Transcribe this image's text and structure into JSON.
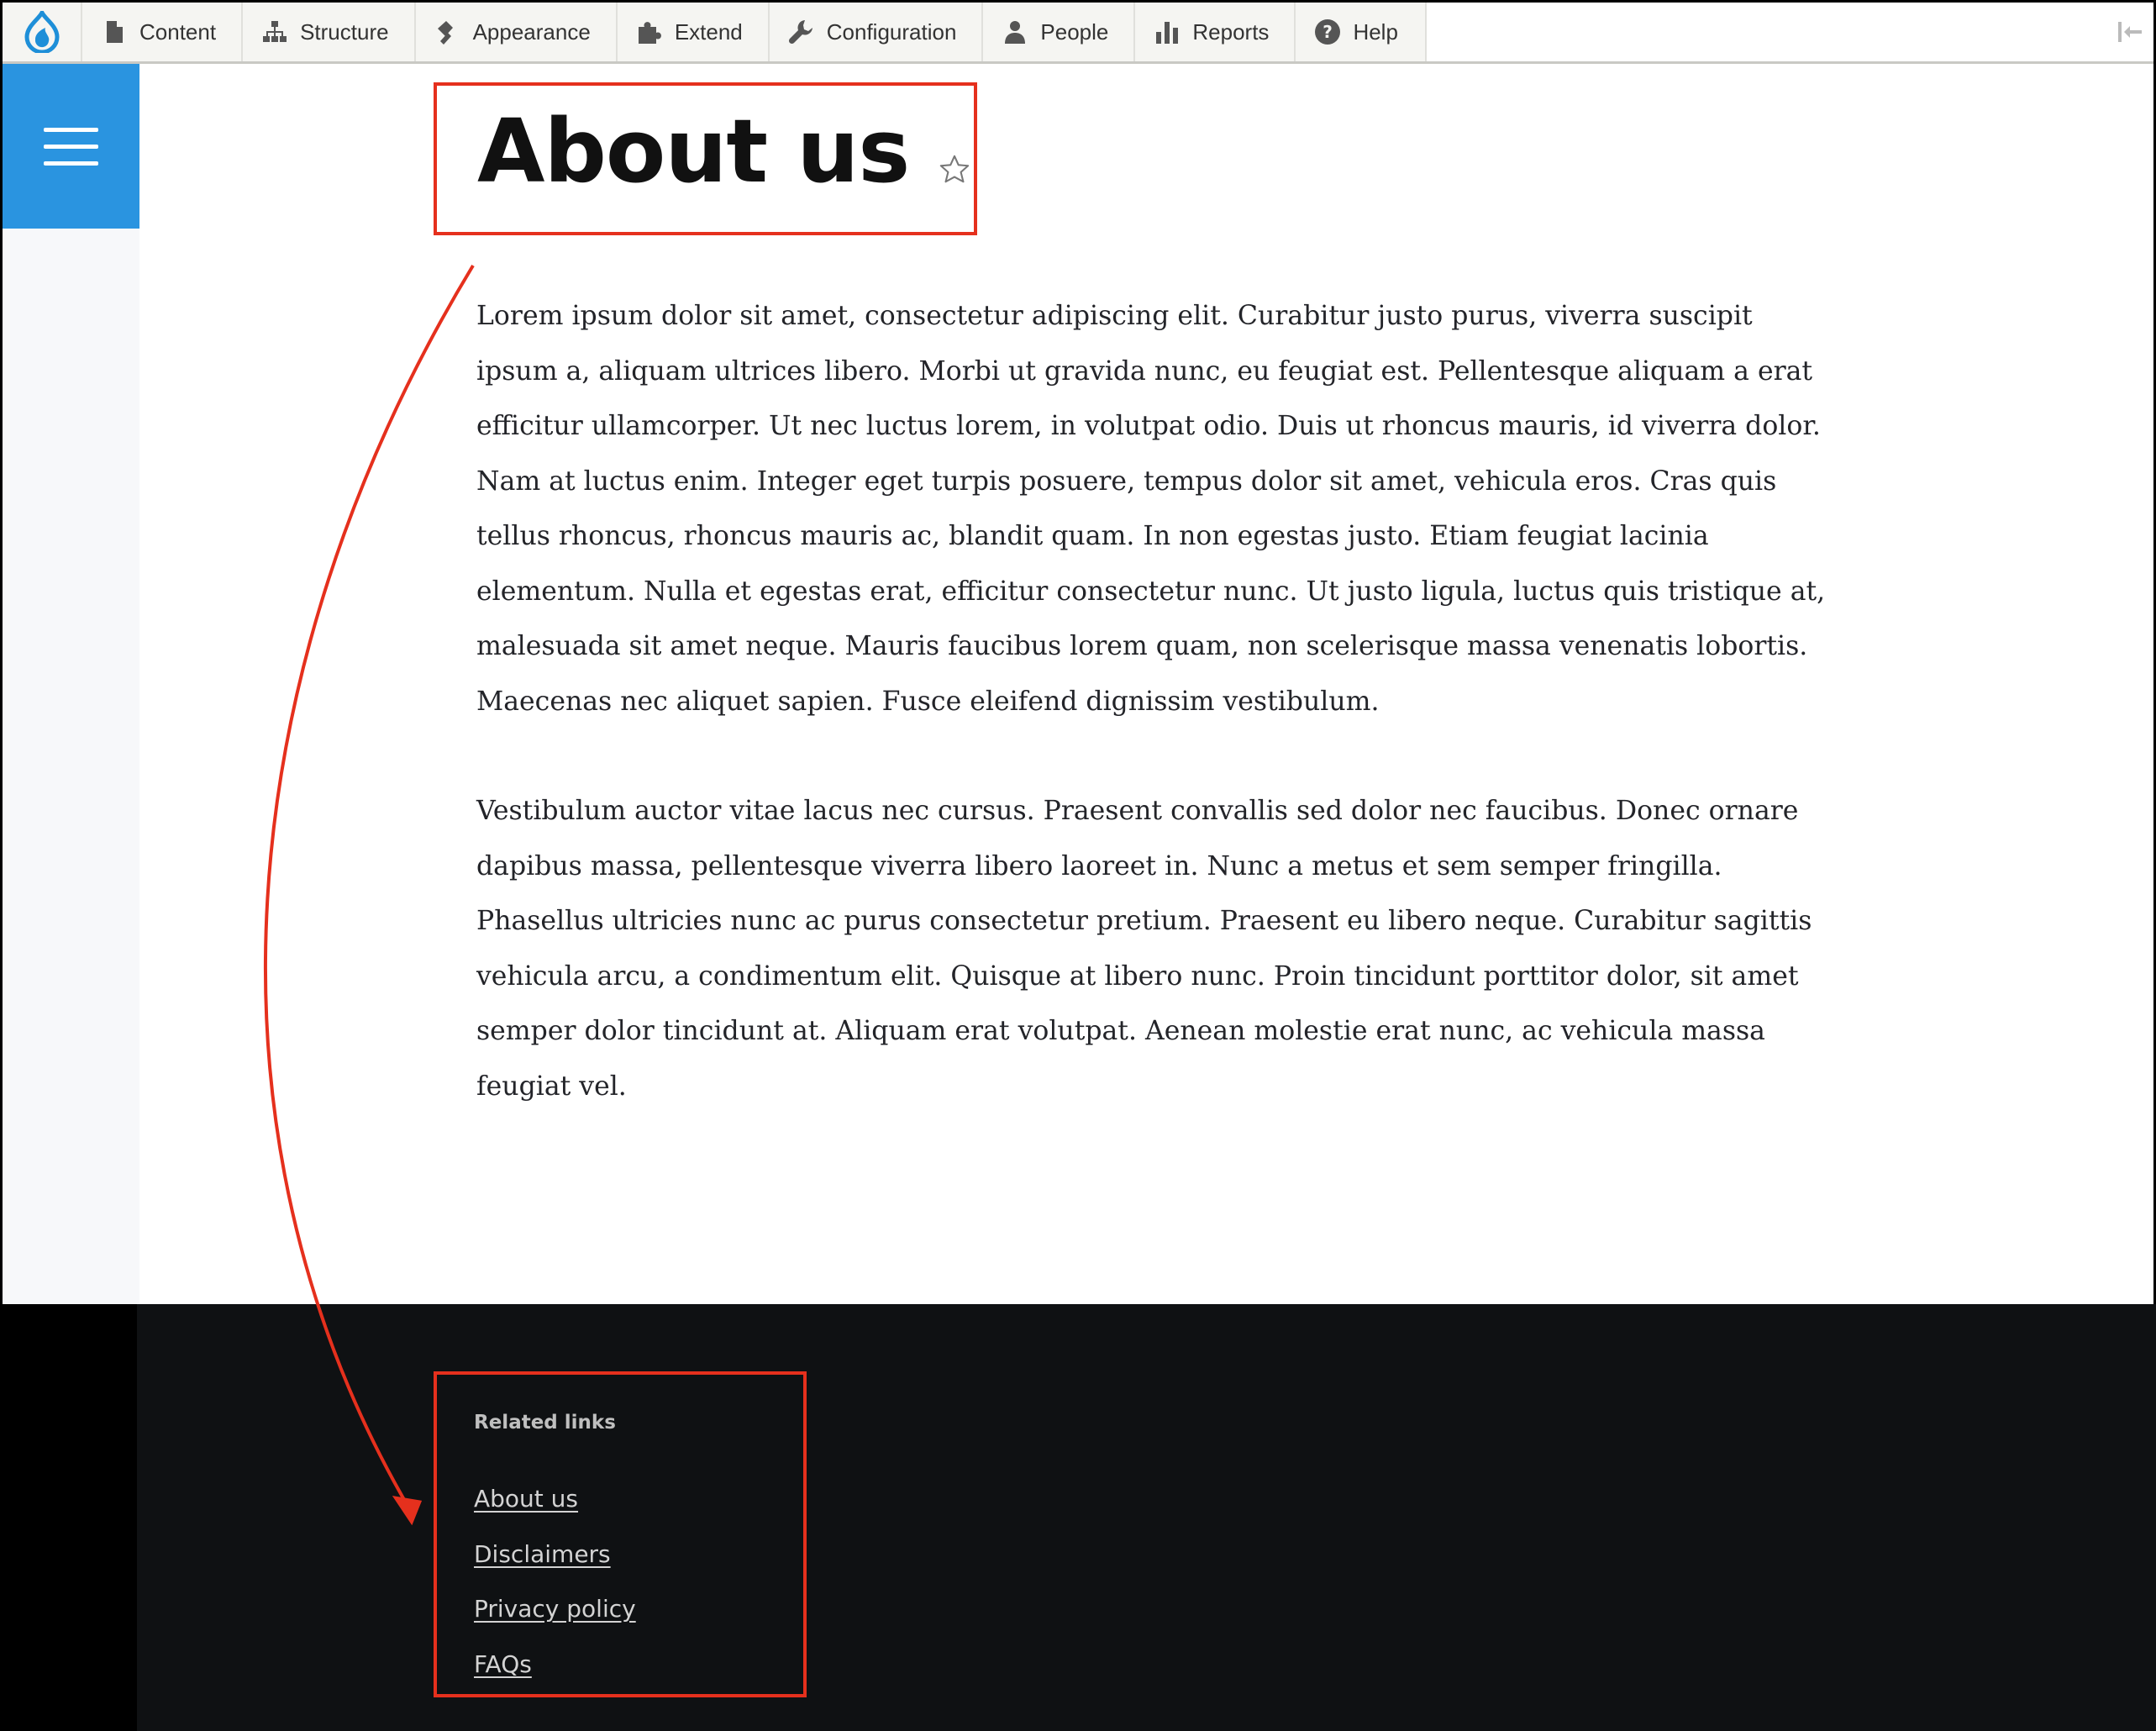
{
  "toolbar": {
    "items": [
      {
        "label": "Content",
        "icon": "file-icon"
      },
      {
        "label": "Structure",
        "icon": "sitemap-icon"
      },
      {
        "label": "Appearance",
        "icon": "paint-roller-icon"
      },
      {
        "label": "Extend",
        "icon": "puzzle-icon"
      },
      {
        "label": "Configuration",
        "icon": "wrench-icon"
      },
      {
        "label": "People",
        "icon": "person-icon"
      },
      {
        "label": "Reports",
        "icon": "bar-chart-icon"
      },
      {
        "label": "Help",
        "icon": "question-icon"
      }
    ]
  },
  "page": {
    "title": "About us",
    "paragraphs": [
      "Lorem ipsum dolor sit amet, consectetur adipiscing elit. Curabitur justo purus, viverra suscipit ipsum a, aliquam ultrices libero. Morbi ut gravida nunc, eu feugiat est. Pellentesque aliquam a erat efficitur ullamcorper. Ut nec luctus lorem, in volutpat odio. Duis ut rhoncus mauris, id viverra dolor. Nam at luctus enim. Integer eget turpis posuere, tempus dolor sit amet, vehicula eros. Cras quis tellus rhoncus, rhoncus mauris ac, blandit quam. In non egestas justo. Etiam feugiat lacinia elementum. Nulla et egestas erat, efficitur consectetur nunc. Ut justo ligula, luctus quis tristique at, malesuada sit amet neque. Mauris faucibus lorem quam, non scelerisque massa venenatis lobortis. Maecenas nec aliquet sapien. Fusce eleifend dignissim vestibulum.",
      "Vestibulum auctor vitae lacus nec cursus. Praesent convallis sed dolor nec faucibus. Donec ornare dapibus massa, pellentesque viverra libero laoreet in. Nunc a metus et sem semper fringilla. Phasellus ultricies nunc ac purus consectetur pretium. Praesent eu libero neque. Curabitur sagittis vehicula arcu, a condimentum elit. Quisque at libero nunc. Proin tincidunt porttitor dolor, sit amet semper dolor tincidunt at. Aliquam erat volutpat. Aenean molestie erat nunc, ac vehicula massa feugiat vel."
    ]
  },
  "footer": {
    "related_title": "Related links",
    "links": [
      "About us",
      "Disclaimers",
      "Privacy policy",
      "FAQs"
    ]
  },
  "colors": {
    "accent": "#2a94e0",
    "annotation": "#e5301d",
    "footer_bg": "#0f1113"
  }
}
